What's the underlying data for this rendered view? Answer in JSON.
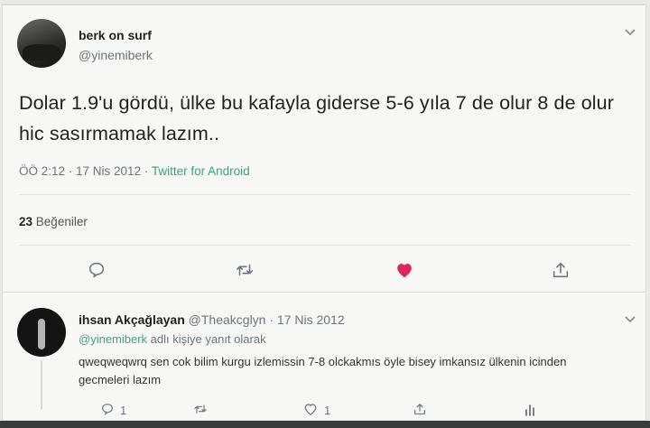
{
  "tweet": {
    "display_name": "berk on surf",
    "handle": "@yinemiberk",
    "text": "Dolar 1.9'u gördü, ülke bu kafayla giderse 5-6 yıla 7 de olur 8 de olur hic sasırmamak lazım..",
    "time": "ÖÖ 2:12 · 17 Nis 2012 · ",
    "source": "Twitter for Android",
    "likes_count": "23",
    "likes_label": "Beğeniler"
  },
  "reply": {
    "display_name": "ihsan Akçağlayan",
    "handle": "@Theakcglyn",
    "date": " · 17 Nis 2012",
    "mention": "@yinemiberk",
    "reply_label": " adlı kişiye yanıt olarak",
    "text": "qweqweqwrq sen cok bilim kurgu izlemissin 7-8 olckakmıs öyle bisey imkansız ülkenin icinden gecmeleri lazım",
    "reply_count": "1",
    "like_count": "1"
  },
  "icons": [
    "chevron-down-icon",
    "reply-icon",
    "retweet-icon",
    "heart-icon",
    "share-icon",
    "analytics-icon"
  ],
  "colors": {
    "accent_green": "#3aa37a",
    "heart_red": "#e0245e"
  }
}
